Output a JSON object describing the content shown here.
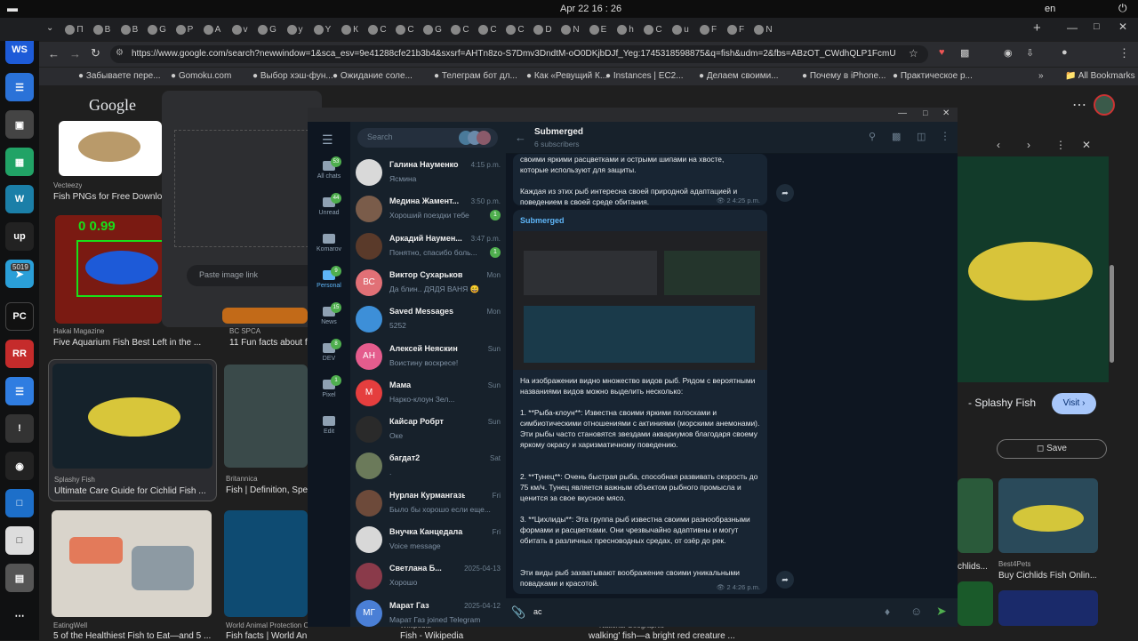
{
  "system": {
    "clock": "Apr 22  16 : 26",
    "lang": "en"
  },
  "browser": {
    "url": "https://www.google.com/search?newwindow=1&sca_esv=9e41288cfe21b3b4&sxsrf=AHTn8zo-S7Dmv3DndtM-oO0DKjbDJf_Yeg:1745318598875&q=fish&udm=2&fbs=ABzOT_CWdhQLP1FcmU5B0f...",
    "tabs": [
      "П",
      "В",
      "В",
      "G",
      "Р",
      "А",
      "v",
      "G",
      "у",
      "Y",
      "К",
      "С",
      "С",
      "G",
      "С",
      "С",
      "С",
      "D",
      "N",
      "Е",
      "h",
      "С",
      "u",
      "F",
      "F",
      "N"
    ],
    "bookmarks": [
      "Забываете пере...",
      "Gomoku.com",
      "Выбор хэш-фун...",
      "Ожидание соле...",
      "Телеграм бот дл...",
      "Как «Ревущий К...",
      "Instances | EC2...",
      "Делаем своими...",
      "Почему в iPhone...",
      "Практическое р..."
    ],
    "all_bookmarks": "All Bookmarks"
  },
  "dock": {
    "badge": "5019"
  },
  "google": {
    "logo": "Google",
    "paste_placeholder": "Paste image link",
    "results": [
      {
        "src": "Vecteezy",
        "title": "Fish PNGs for Free Download"
      },
      {
        "src": "Hakai Magazine",
        "title": "Five Aquarium Fish Best Left in the ..."
      },
      {
        "src": "BC SPCA",
        "title": "11 Fun facts about fi"
      },
      {
        "src": "Splashy Fish",
        "title": "Ultimate Care Guide for Cichlid Fish ..."
      },
      {
        "src": "Britannica",
        "title": "Fish | Definition, Spec"
      },
      {
        "src": "EatingWell",
        "title": "5 of the Healthiest Fish to Eat—and 5 ..."
      },
      {
        "src": "World Animal Protection Canada",
        "title": "Fish facts | World Animal Protection"
      },
      {
        "src": "Wikipedia",
        "title": "Fish - Wikipedia"
      },
      {
        "src": "National Geographic",
        "title": "walking' fish—a bright red creature ..."
      }
    ],
    "detection": "0 0.99",
    "panel": {
      "site": "- Splashy Fish",
      "visit": "Visit",
      "save": "Save",
      "related": [
        {
          "title": "chlids..."
        },
        {
          "src": "Best4Pets",
          "title": "Buy Cichlids Fish Onlin..."
        }
      ]
    }
  },
  "telegram": {
    "search_placeholder": "Search",
    "folders": [
      {
        "label": "All chats",
        "badge": "53"
      },
      {
        "label": "Unread",
        "badge": "44"
      },
      {
        "label": "Komarov",
        "badge": ""
      },
      {
        "label": "Personal",
        "badge": "9"
      },
      {
        "label": "News",
        "badge": "15"
      },
      {
        "label": "DEV",
        "badge": "8"
      },
      {
        "label": "Pixel",
        "badge": "1"
      },
      {
        "label": "Edit",
        "badge": ""
      }
    ],
    "chats": [
      {
        "name": "Галина Науменко",
        "time": "4:15 p.m.",
        "preview": "Ясмина",
        "unread": "",
        "initials": "",
        "color": "#d9d9d9"
      },
      {
        "name": "Медина Жамент...",
        "time": "3:50 p.m.",
        "preview": "Хороший поездки тебе",
        "unread": "1",
        "initials": "",
        "color": "#7a5c4a"
      },
      {
        "name": "Аркадий Наумен...",
        "time": "3:47 p.m.",
        "preview": "Понятно, спасибо боль...",
        "unread": "1",
        "initials": "",
        "color": "#5a3a2a"
      },
      {
        "name": "Виктор Сухарьков",
        "time": "Mon",
        "preview": "Да блин.. ДЯДЯ ВАНЯ 😄",
        "unread": "",
        "initials": "ВС",
        "color": "#e17076"
      },
      {
        "name": "Saved Messages",
        "time": "Mon",
        "preview": "5252",
        "unread": "",
        "initials": "",
        "color": "#3d8fd8"
      },
      {
        "name": "Алексей Неяскин",
        "time": "Sun",
        "preview": "Воистину воскресе!",
        "unread": "",
        "initials": "АН",
        "color": "#e45c8d"
      },
      {
        "name": "Мама",
        "time": "Sun",
        "preview": "Нарко-клоун Зел...",
        "unread": "",
        "initials": "М",
        "color": "#e53e3e"
      },
      {
        "name": "Кайсар Робрт",
        "time": "Sun",
        "preview": "Оке",
        "unread": "",
        "initials": "",
        "color": "#2a2a2a"
      },
      {
        "name": "багдат2",
        "time": "Sat",
        "preview": ".",
        "unread": "",
        "initials": "",
        "color": "#6b7a5a"
      },
      {
        "name": "Нурлан Курмангазы",
        "time": "Fri",
        "preview": "Было бы хорошо если еще...",
        "unread": "",
        "initials": "",
        "color": "#6d4a3a"
      },
      {
        "name": "Внучка Канцедала",
        "time": "Fri",
        "preview": "Voice message",
        "unread": "",
        "initials": "",
        "color": "#d8d8d8"
      },
      {
        "name": "Светлана Б...",
        "time": "2025-04-13",
        "preview": "Хорошо",
        "unread": "",
        "initials": "",
        "color": "#8a3a4a"
      },
      {
        "name": "Марат Газ",
        "time": "2025-04-12",
        "preview": "Марат Газ joined Telegram",
        "unread": "",
        "initials": "МГ",
        "color": "#4a7fd6"
      }
    ],
    "channel": {
      "name": "Submerged",
      "subs": "6 subscribers"
    },
    "msg1": {
      "line1": "своими яркими расцветками и острыми шипами на хвосте,",
      "line2": "которые используют для защиты.",
      "para": "Каждая из этих рыб интересна своей природной адаптацией и поведением в своей среде обитания.",
      "views": "2",
      "time": "4:25 p.m."
    },
    "msg2": {
      "author": "Submerged",
      "intro": "На изображении видно множество видов рыб. Рядом с вероятными названиями видов можно выделить несколько:",
      "item1": "1. **Рыба-клоун**: Известна своими яркими полосками и симбиотическими отношениями с актиниями (морскими анемонами). Эти рыбы часто становятся звездами аквариумов благодаря своему яркому окрасу и харизматичному поведению.",
      "item2": "2. **Тунец**: Очень быстрая рыба, способная развивать скорость до 75 км/ч. Тунец является важным объектом рыбного промысла и ценится за свое вкусное мясо.",
      "item3": "3. **Цихлиды**: Эта группа рыб известна своими разнообразными формами и расцветками. Они чрезвычайно адаптивны и могут обитать в различных пресноводных средах, от озёр до рек.",
      "outro": "Эти виды рыб захватывают воображение своими уникальными повадками и красотой.",
      "views": "2",
      "time": "4:26 p.m."
    },
    "composer_value": "ac"
  },
  "colors": {
    "accent": "#5eb5f7",
    "green": "#4fae4e",
    "tg_bg": "#0e1621"
  }
}
